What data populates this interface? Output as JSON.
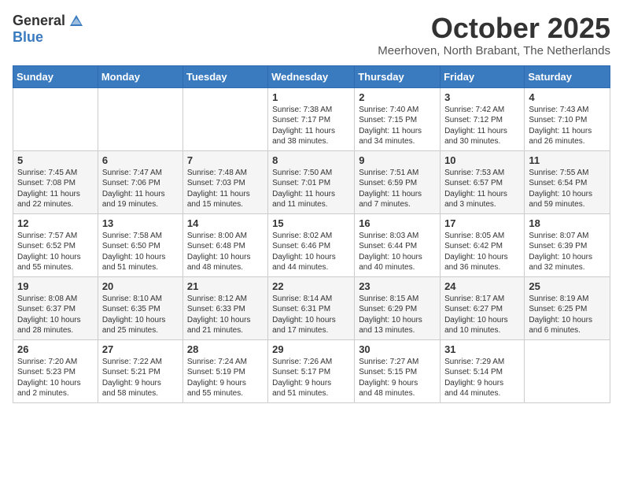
{
  "header": {
    "logo_general": "General",
    "logo_blue": "Blue",
    "month_title": "October 2025",
    "location": "Meerhoven, North Brabant, The Netherlands"
  },
  "weekdays": [
    "Sunday",
    "Monday",
    "Tuesday",
    "Wednesday",
    "Thursday",
    "Friday",
    "Saturday"
  ],
  "weeks": [
    [
      {
        "day": "",
        "info": ""
      },
      {
        "day": "",
        "info": ""
      },
      {
        "day": "",
        "info": ""
      },
      {
        "day": "1",
        "info": "Sunrise: 7:38 AM\nSunset: 7:17 PM\nDaylight: 11 hours\nand 38 minutes."
      },
      {
        "day": "2",
        "info": "Sunrise: 7:40 AM\nSunset: 7:15 PM\nDaylight: 11 hours\nand 34 minutes."
      },
      {
        "day": "3",
        "info": "Sunrise: 7:42 AM\nSunset: 7:12 PM\nDaylight: 11 hours\nand 30 minutes."
      },
      {
        "day": "4",
        "info": "Sunrise: 7:43 AM\nSunset: 7:10 PM\nDaylight: 11 hours\nand 26 minutes."
      }
    ],
    [
      {
        "day": "5",
        "info": "Sunrise: 7:45 AM\nSunset: 7:08 PM\nDaylight: 11 hours\nand 22 minutes."
      },
      {
        "day": "6",
        "info": "Sunrise: 7:47 AM\nSunset: 7:06 PM\nDaylight: 11 hours\nand 19 minutes."
      },
      {
        "day": "7",
        "info": "Sunrise: 7:48 AM\nSunset: 7:03 PM\nDaylight: 11 hours\nand 15 minutes."
      },
      {
        "day": "8",
        "info": "Sunrise: 7:50 AM\nSunset: 7:01 PM\nDaylight: 11 hours\nand 11 minutes."
      },
      {
        "day": "9",
        "info": "Sunrise: 7:51 AM\nSunset: 6:59 PM\nDaylight: 11 hours\nand 7 minutes."
      },
      {
        "day": "10",
        "info": "Sunrise: 7:53 AM\nSunset: 6:57 PM\nDaylight: 11 hours\nand 3 minutes."
      },
      {
        "day": "11",
        "info": "Sunrise: 7:55 AM\nSunset: 6:54 PM\nDaylight: 10 hours\nand 59 minutes."
      }
    ],
    [
      {
        "day": "12",
        "info": "Sunrise: 7:57 AM\nSunset: 6:52 PM\nDaylight: 10 hours\nand 55 minutes."
      },
      {
        "day": "13",
        "info": "Sunrise: 7:58 AM\nSunset: 6:50 PM\nDaylight: 10 hours\nand 51 minutes."
      },
      {
        "day": "14",
        "info": "Sunrise: 8:00 AM\nSunset: 6:48 PM\nDaylight: 10 hours\nand 48 minutes."
      },
      {
        "day": "15",
        "info": "Sunrise: 8:02 AM\nSunset: 6:46 PM\nDaylight: 10 hours\nand 44 minutes."
      },
      {
        "day": "16",
        "info": "Sunrise: 8:03 AM\nSunset: 6:44 PM\nDaylight: 10 hours\nand 40 minutes."
      },
      {
        "day": "17",
        "info": "Sunrise: 8:05 AM\nSunset: 6:42 PM\nDaylight: 10 hours\nand 36 minutes."
      },
      {
        "day": "18",
        "info": "Sunrise: 8:07 AM\nSunset: 6:39 PM\nDaylight: 10 hours\nand 32 minutes."
      }
    ],
    [
      {
        "day": "19",
        "info": "Sunrise: 8:08 AM\nSunset: 6:37 PM\nDaylight: 10 hours\nand 28 minutes."
      },
      {
        "day": "20",
        "info": "Sunrise: 8:10 AM\nSunset: 6:35 PM\nDaylight: 10 hours\nand 25 minutes."
      },
      {
        "day": "21",
        "info": "Sunrise: 8:12 AM\nSunset: 6:33 PM\nDaylight: 10 hours\nand 21 minutes."
      },
      {
        "day": "22",
        "info": "Sunrise: 8:14 AM\nSunset: 6:31 PM\nDaylight: 10 hours\nand 17 minutes."
      },
      {
        "day": "23",
        "info": "Sunrise: 8:15 AM\nSunset: 6:29 PM\nDaylight: 10 hours\nand 13 minutes."
      },
      {
        "day": "24",
        "info": "Sunrise: 8:17 AM\nSunset: 6:27 PM\nDaylight: 10 hours\nand 10 minutes."
      },
      {
        "day": "25",
        "info": "Sunrise: 8:19 AM\nSunset: 6:25 PM\nDaylight: 10 hours\nand 6 minutes."
      }
    ],
    [
      {
        "day": "26",
        "info": "Sunrise: 7:20 AM\nSunset: 5:23 PM\nDaylight: 10 hours\nand 2 minutes."
      },
      {
        "day": "27",
        "info": "Sunrise: 7:22 AM\nSunset: 5:21 PM\nDaylight: 9 hours\nand 58 minutes."
      },
      {
        "day": "28",
        "info": "Sunrise: 7:24 AM\nSunset: 5:19 PM\nDaylight: 9 hours\nand 55 minutes."
      },
      {
        "day": "29",
        "info": "Sunrise: 7:26 AM\nSunset: 5:17 PM\nDaylight: 9 hours\nand 51 minutes."
      },
      {
        "day": "30",
        "info": "Sunrise: 7:27 AM\nSunset: 5:15 PM\nDaylight: 9 hours\nand 48 minutes."
      },
      {
        "day": "31",
        "info": "Sunrise: 7:29 AM\nSunset: 5:14 PM\nDaylight: 9 hours\nand 44 minutes."
      },
      {
        "day": "",
        "info": ""
      }
    ]
  ]
}
